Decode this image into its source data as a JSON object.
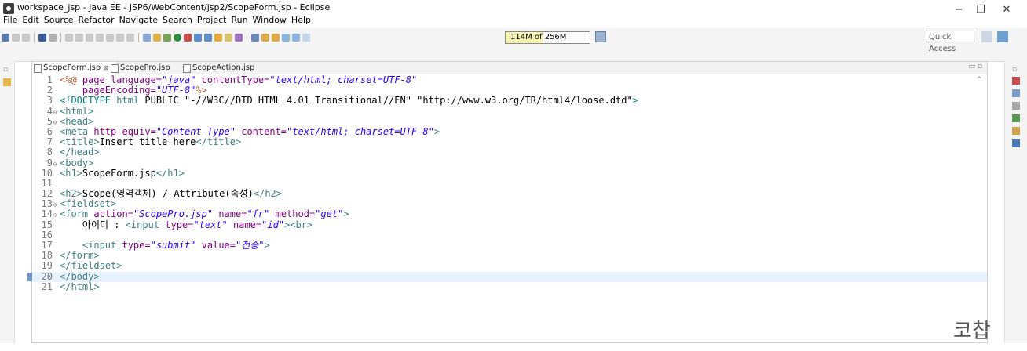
{
  "window": {
    "title": "workspace_jsp - Java EE - JSP6/WebContent/jsp2/ScopeForm.jsp - Eclipse",
    "minimize": "−",
    "restore": "❐",
    "close": "✕"
  },
  "menu": [
    "File",
    "Edit",
    "Source",
    "Refactor",
    "Navigate",
    "Search",
    "Project",
    "Run",
    "Window",
    "Help"
  ],
  "toolbar": {
    "heap_text": "114M of 256M",
    "heap_fraction": 0.445,
    "quick_access": "Quick Access"
  },
  "tabs": [
    {
      "label": "ScopeForm.jsp",
      "active": true,
      "close": "⊠"
    },
    {
      "label": "ScopePro.jsp",
      "active": false
    },
    {
      "label": "ScopeAction.jsp",
      "active": false
    }
  ],
  "code_lines": [
    {
      "n": "1",
      "fold": "",
      "segs": [
        [
          "jsp",
          "<%@"
        ],
        [
          "txt",
          " "
        ],
        [
          "attr",
          "page language="
        ],
        [
          "str",
          "\"java\""
        ],
        [
          "txt",
          " "
        ],
        [
          "attr",
          "contentType="
        ],
        [
          "str",
          "\"text/html; charset=UTF-8\""
        ]
      ]
    },
    {
      "n": "2",
      "fold": "",
      "segs": [
        [
          "txt",
          "    "
        ],
        [
          "attr",
          "pageEncoding="
        ],
        [
          "str",
          "\"UTF-8\""
        ],
        [
          "jsp",
          "%>"
        ]
      ]
    },
    {
      "n": "3",
      "fold": "",
      "segs": [
        [
          "dt",
          "<!DOCTYPE"
        ],
        [
          "txt",
          " "
        ],
        [
          "tag",
          "html"
        ],
        [
          "txt",
          " PUBLIC "
        ],
        [
          "txt",
          "\"-//W3C//DTD HTML 4.01 Transitional//EN\" \"http://www.w3.org/TR/html4/loose.dtd\""
        ],
        [
          "dt",
          ">"
        ]
      ]
    },
    {
      "n": "4",
      "fold": "⊖",
      "segs": [
        [
          "tag",
          "<html>"
        ]
      ]
    },
    {
      "n": "5",
      "fold": "⊖",
      "segs": [
        [
          "tag",
          "<head>"
        ]
      ]
    },
    {
      "n": "6",
      "fold": "",
      "segs": [
        [
          "tag",
          "<meta "
        ],
        [
          "attr",
          "http-equiv="
        ],
        [
          "str",
          "\"Content-Type\""
        ],
        [
          "txt",
          " "
        ],
        [
          "attr",
          "content="
        ],
        [
          "str",
          "\"text/html; charset=UTF-8\""
        ],
        [
          "tag",
          ">"
        ]
      ]
    },
    {
      "n": "7",
      "fold": "",
      "segs": [
        [
          "tag",
          "<title>"
        ],
        [
          "txt",
          "Insert title here"
        ],
        [
          "tag",
          "</title>"
        ]
      ]
    },
    {
      "n": "8",
      "fold": "",
      "segs": [
        [
          "tag",
          "</head>"
        ]
      ]
    },
    {
      "n": "9",
      "fold": "⊖",
      "segs": [
        [
          "tag",
          "<body>"
        ]
      ]
    },
    {
      "n": "10",
      "fold": "",
      "segs": [
        [
          "tag",
          "<h1>"
        ],
        [
          "txt",
          "ScopeForm.jsp"
        ],
        [
          "tag",
          "</h1>"
        ]
      ]
    },
    {
      "n": "11",
      "fold": "",
      "segs": []
    },
    {
      "n": "12",
      "fold": "",
      "segs": [
        [
          "tag",
          "<h2>"
        ],
        [
          "txt",
          "Scope(영역객체) / Attribute(속성)"
        ],
        [
          "tag",
          "</h2>"
        ]
      ]
    },
    {
      "n": "13",
      "fold": "⊖",
      "segs": [
        [
          "tag",
          "<fieldset>"
        ]
      ]
    },
    {
      "n": "14",
      "fold": "⊖",
      "segs": [
        [
          "tag",
          "<form "
        ],
        [
          "attr",
          "action="
        ],
        [
          "str",
          "\"ScopePro.jsp\""
        ],
        [
          "txt",
          " "
        ],
        [
          "attr",
          "name="
        ],
        [
          "str",
          "\"fr\""
        ],
        [
          "txt",
          " "
        ],
        [
          "attr",
          "method="
        ],
        [
          "str",
          "\"get\""
        ],
        [
          "tag",
          ">"
        ]
      ]
    },
    {
      "n": "15",
      "fold": "",
      "segs": [
        [
          "txt",
          "    아이디 : "
        ],
        [
          "tag",
          "<input "
        ],
        [
          "attr",
          "type="
        ],
        [
          "str",
          "\"text\""
        ],
        [
          "txt",
          " "
        ],
        [
          "attr",
          "name="
        ],
        [
          "str",
          "\"id\""
        ],
        [
          "tag",
          "><br>"
        ]
      ]
    },
    {
      "n": "16",
      "fold": "",
      "segs": []
    },
    {
      "n": "17",
      "fold": "",
      "segs": [
        [
          "txt",
          "    "
        ],
        [
          "tag",
          "<input "
        ],
        [
          "attr",
          "type="
        ],
        [
          "str",
          "\"submit\""
        ],
        [
          "txt",
          " "
        ],
        [
          "attr",
          "value="
        ],
        [
          "str",
          "\"전송\""
        ],
        [
          "tag",
          ">"
        ]
      ]
    },
    {
      "n": "18",
      "fold": "",
      "segs": [
        [
          "tag",
          "</form>"
        ]
      ]
    },
    {
      "n": "19",
      "fold": "",
      "segs": [
        [
          "tag",
          "</fieldset>"
        ]
      ]
    },
    {
      "n": "20",
      "fold": "",
      "current": true,
      "segs": [
        [
          "tag",
          "</body>"
        ]
      ]
    },
    {
      "n": "21",
      "fold": "",
      "segs": [
        [
          "tag",
          "</html>"
        ]
      ]
    }
  ],
  "watermark": "코찹"
}
